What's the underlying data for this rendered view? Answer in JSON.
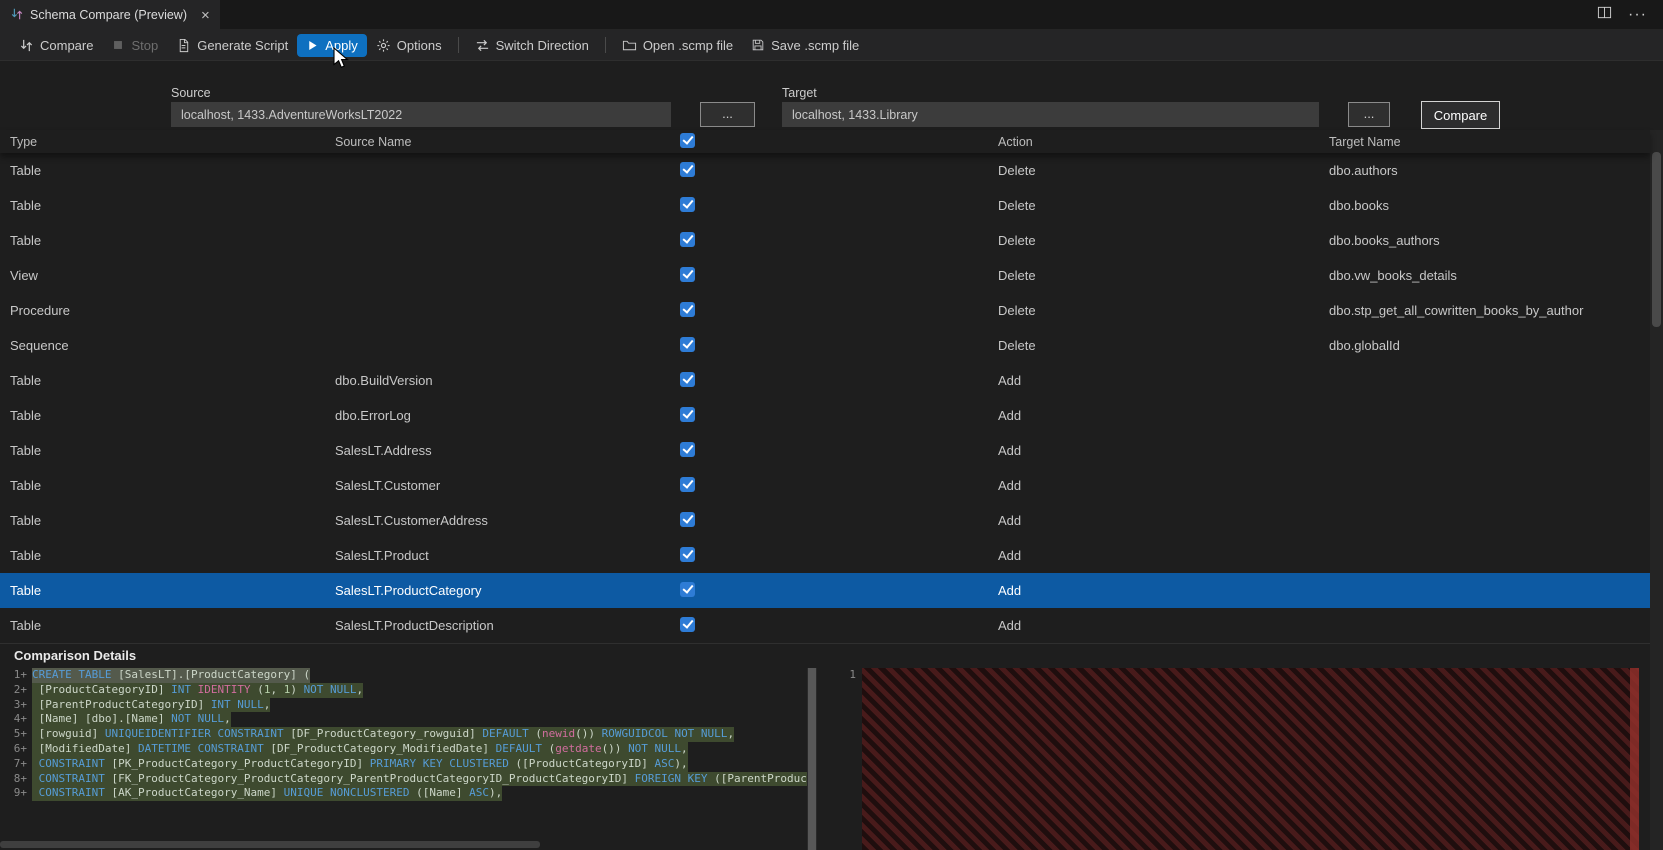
{
  "window": {
    "tab_title": "Schema Compare (Preview)",
    "close_icon": "×",
    "more_actions_icon": "···"
  },
  "toolbar": {
    "items": [
      {
        "id": "compare",
        "label": "Compare",
        "icon": "compare-icon",
        "state": "normal"
      },
      {
        "id": "stop",
        "label": "Stop",
        "icon": "stop-icon",
        "state": "disabled"
      },
      {
        "id": "generate-script",
        "label": "Generate Script",
        "icon": "script-icon",
        "state": "normal"
      },
      {
        "id": "apply",
        "label": "Apply",
        "icon": "play-icon",
        "state": "active"
      },
      {
        "id": "options",
        "label": "Options",
        "icon": "gear-icon",
        "state": "normal"
      },
      {
        "id": "sep1",
        "separator": true
      },
      {
        "id": "switch-direction",
        "label": "Switch Direction",
        "icon": "switch-icon",
        "state": "normal"
      },
      {
        "id": "sep2",
        "separator": true
      },
      {
        "id": "open-scmp",
        "label": "Open .scmp file",
        "icon": "open-file-icon",
        "state": "normal"
      },
      {
        "id": "save-scmp",
        "label": "Save .scmp file",
        "icon": "save-icon",
        "state": "normal"
      }
    ]
  },
  "connections": {
    "source": {
      "label": "Source",
      "value": "localhost, 1433.AdventureWorksLT2022",
      "browse": "..."
    },
    "target": {
      "label": "Target",
      "value": "localhost, 1433.Library",
      "browse": "..."
    },
    "compare_button": "Compare"
  },
  "grid": {
    "header": {
      "type": "Type",
      "source": "Source Name",
      "action": "Action",
      "target": "Target Name",
      "checkbox_checked": true
    },
    "rows": [
      {
        "type": "Table",
        "source_name": "",
        "action": "Delete",
        "target_name": "dbo.authors",
        "checked": true,
        "selected": false
      },
      {
        "type": "Table",
        "source_name": "",
        "action": "Delete",
        "target_name": "dbo.books",
        "checked": true,
        "selected": false
      },
      {
        "type": "Table",
        "source_name": "",
        "action": "Delete",
        "target_name": "dbo.books_authors",
        "checked": true,
        "selected": false
      },
      {
        "type": "View",
        "source_name": "",
        "action": "Delete",
        "target_name": "dbo.vw_books_details",
        "checked": true,
        "selected": false
      },
      {
        "type": "Procedure",
        "source_name": "",
        "action": "Delete",
        "target_name": "dbo.stp_get_all_cowritten_books_by_author",
        "checked": true,
        "selected": false
      },
      {
        "type": "Sequence",
        "source_name": "",
        "action": "Delete",
        "target_name": "dbo.globalId",
        "checked": true,
        "selected": false
      },
      {
        "type": "Table",
        "source_name": "dbo.BuildVersion",
        "action": "Add",
        "target_name": "",
        "checked": true,
        "selected": false
      },
      {
        "type": "Table",
        "source_name": "dbo.ErrorLog",
        "action": "Add",
        "target_name": "",
        "checked": true,
        "selected": false
      },
      {
        "type": "Table",
        "source_name": "SalesLT.Address",
        "action": "Add",
        "target_name": "",
        "checked": true,
        "selected": false
      },
      {
        "type": "Table",
        "source_name": "SalesLT.Customer",
        "action": "Add",
        "target_name": "",
        "checked": true,
        "selected": false
      },
      {
        "type": "Table",
        "source_name": "SalesLT.CustomerAddress",
        "action": "Add",
        "target_name": "",
        "checked": true,
        "selected": false
      },
      {
        "type": "Table",
        "source_name": "SalesLT.Product",
        "action": "Add",
        "target_name": "",
        "checked": true,
        "selected": false
      },
      {
        "type": "Table",
        "source_name": "SalesLT.ProductCategory",
        "action": "Add",
        "target_name": "",
        "checked": true,
        "selected": true
      },
      {
        "type": "Table",
        "source_name": "SalesLT.ProductDescription",
        "action": "Add",
        "target_name": "",
        "checked": true,
        "selected": false
      }
    ]
  },
  "details": {
    "title": "Comparison Details",
    "left": {
      "lines": [
        {
          "num": "1",
          "diff": "+",
          "hl": "first",
          "tokens": [
            [
              "k",
              "CREATE TABLE "
            ],
            [
              "d",
              "[SalesLT].[ProductCategory] ("
            ]
          ]
        },
        {
          "num": "2",
          "diff": "+",
          "hl": "add",
          "tokens": [
            [
              "d",
              " [ProductCategoryID] "
            ],
            [
              "k",
              "INT "
            ],
            [
              "f",
              "IDENTITY "
            ],
            [
              "d",
              "("
            ],
            [
              "n",
              "1"
            ],
            [
              "d",
              ", "
            ],
            [
              "n",
              "1"
            ],
            [
              "d",
              ") "
            ],
            [
              "k",
              "NOT NULL"
            ],
            [
              "d",
              ","
            ]
          ]
        },
        {
          "num": "3",
          "diff": "+",
          "hl": "add",
          "tokens": [
            [
              "d",
              " [ParentProductCategoryID] "
            ],
            [
              "k",
              "INT NULL"
            ],
            [
              "d",
              ","
            ]
          ]
        },
        {
          "num": "4",
          "diff": "+",
          "hl": "add",
          "tokens": [
            [
              "d",
              " [Name] [dbo].[Name] "
            ],
            [
              "k",
              "NOT NULL"
            ],
            [
              "d",
              ","
            ]
          ]
        },
        {
          "num": "5",
          "diff": "+",
          "hl": "add",
          "tokens": [
            [
              "d",
              " [rowguid] "
            ],
            [
              "k",
              "UNIQUEIDENTIFIER CONSTRAINT "
            ],
            [
              "d",
              "[DF_ProductCategory_rowguid] "
            ],
            [
              "k",
              "DEFAULT "
            ],
            [
              "d",
              "("
            ],
            [
              "f",
              "newid"
            ],
            [
              "d",
              "()) "
            ],
            [
              "k",
              "ROWGUIDCOL NOT NULL"
            ],
            [
              "d",
              ","
            ]
          ]
        },
        {
          "num": "6",
          "diff": "+",
          "hl": "add",
          "tokens": [
            [
              "d",
              " [ModifiedDate] "
            ],
            [
              "k",
              "DATETIME CONSTRAINT "
            ],
            [
              "d",
              "[DF_ProductCategory_ModifiedDate] "
            ],
            [
              "k",
              "DEFAULT "
            ],
            [
              "d",
              "("
            ],
            [
              "f",
              "getdate"
            ],
            [
              "d",
              "()) "
            ],
            [
              "k",
              "NOT NULL"
            ],
            [
              "d",
              ","
            ]
          ]
        },
        {
          "num": "7",
          "diff": "+",
          "hl": "add",
          "tokens": [
            [
              "d",
              " "
            ],
            [
              "k",
              "CONSTRAINT "
            ],
            [
              "d",
              "[PK_ProductCategory_ProductCategoryID] "
            ],
            [
              "k",
              "PRIMARY KEY CLUSTERED "
            ],
            [
              "d",
              "([ProductCategoryID] "
            ],
            [
              "k",
              "ASC"
            ],
            [
              "d",
              "),"
            ]
          ]
        },
        {
          "num": "8",
          "diff": "+",
          "hl": "add",
          "tokens": [
            [
              "d",
              " "
            ],
            [
              "k",
              "CONSTRAINT "
            ],
            [
              "d",
              "[FK_ProductCategory_ProductCategory_ParentProductCategoryID_ProductCategoryID] "
            ],
            [
              "k",
              "FOREIGN KEY "
            ],
            [
              "d",
              "([ParentProductCatego"
            ]
          ]
        },
        {
          "num": "9",
          "diff": "+",
          "hl": "add",
          "tokens": [
            [
              "d",
              " "
            ],
            [
              "k",
              "CONSTRAINT "
            ],
            [
              "d",
              "[AK_ProductCategory_Name] "
            ],
            [
              "k",
              "UNIQUE NONCLUSTERED "
            ],
            [
              "d",
              "([Name] "
            ],
            [
              "k",
              "ASC"
            ],
            [
              "d",
              "),"
            ]
          ]
        }
      ]
    },
    "right": {
      "line_num": "1"
    }
  },
  "colors": {
    "selection_blue": "#0d5aa3",
    "checkbox_blue": "#2e7cd6",
    "apply_active_blue": "#0e70c0",
    "added_line_bg": "#3e4a2f",
    "removed_hatch_bg": "#331717",
    "keyword": "#569cd6",
    "function": "#d16d9e",
    "number": "#b5cea8"
  }
}
